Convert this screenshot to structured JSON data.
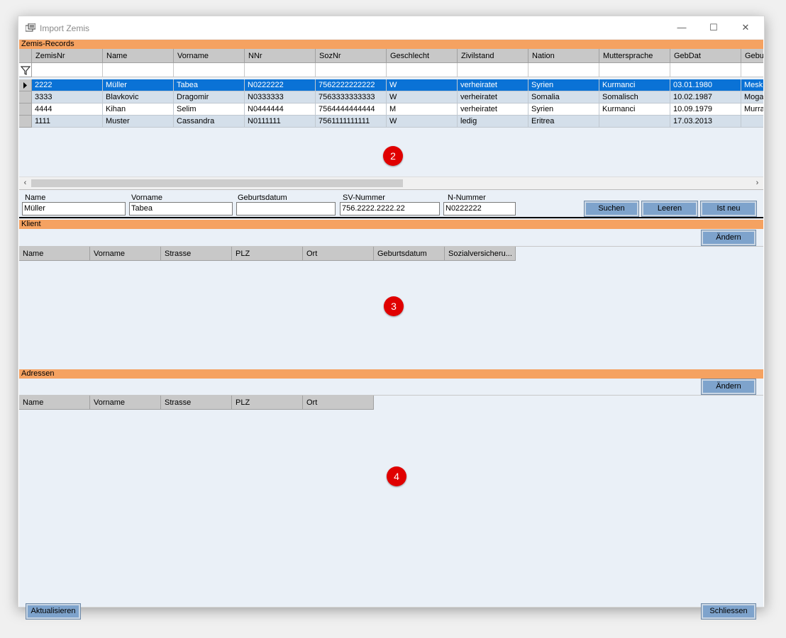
{
  "window": {
    "title": "Import Zemis",
    "minimize": "—",
    "maximize": "☐",
    "close": "✕"
  },
  "zemis": {
    "header": "Zemis-Records",
    "columns": [
      "ZemisNr",
      "Name",
      "Vorname",
      "NNr",
      "SozNr",
      "Geschlecht",
      "Zivilstand",
      "Nation",
      "Muttersprache",
      "GebDat",
      "Geburt"
    ],
    "rows": [
      [
        "2222",
        "Müller",
        "Tabea",
        "N0222222",
        "7562222222222",
        "W",
        "verheiratet",
        "Syrien",
        "Kurmanci",
        "03.01.1980",
        "Mesk"
      ],
      [
        "3333",
        "Blavkovic",
        "Dragomir",
        "N0333333",
        "7563333333333",
        "W",
        "verheiratet",
        "Somalia",
        "Somalisch",
        "10.02.1987",
        "Moga"
      ],
      [
        "4444",
        "Kihan",
        "Selim",
        "N0444444",
        "7564444444444",
        "M",
        "verheiratet",
        "Syrien",
        "Kurmanci",
        "10.09.1979",
        "Murra"
      ],
      [
        "1111",
        "Muster",
        "Cassandra",
        "N0111111",
        "7561111111111",
        "W",
        "ledig",
        "Eritrea",
        "",
        "17.03.2013",
        ""
      ]
    ],
    "selected_row": 0,
    "badge": "2"
  },
  "search": {
    "name_label": "Name",
    "name_value": "Müller",
    "vorname_label": "Vorname",
    "vorname_value": "Tabea",
    "geburtsdatum_label": "Geburtsdatum",
    "geburtsdatum_value": "",
    "sv_label": "SV-Nummer",
    "sv_value": "756.2222.2222.22",
    "n_label": "N-Nummer",
    "n_value": "N0222222",
    "suchen": "Suchen",
    "leeren": "Leeren",
    "ist_neu": "Ist neu"
  },
  "klient": {
    "header": "Klient",
    "aendern": "Ändern",
    "columns": [
      "Name",
      "Vorname",
      "Strasse",
      "PLZ",
      "Ort",
      "Geburtsdatum",
      "Sozialversicheru..."
    ],
    "badge": "3"
  },
  "adressen": {
    "header": "Adressen",
    "aendern": "Ändern",
    "columns": [
      "Name",
      "Vorname",
      "Strasse",
      "PLZ",
      "Ort"
    ],
    "badge": "4"
  },
  "footer": {
    "aktualisieren": "Aktualisieren",
    "schliessen": "Schliessen"
  }
}
